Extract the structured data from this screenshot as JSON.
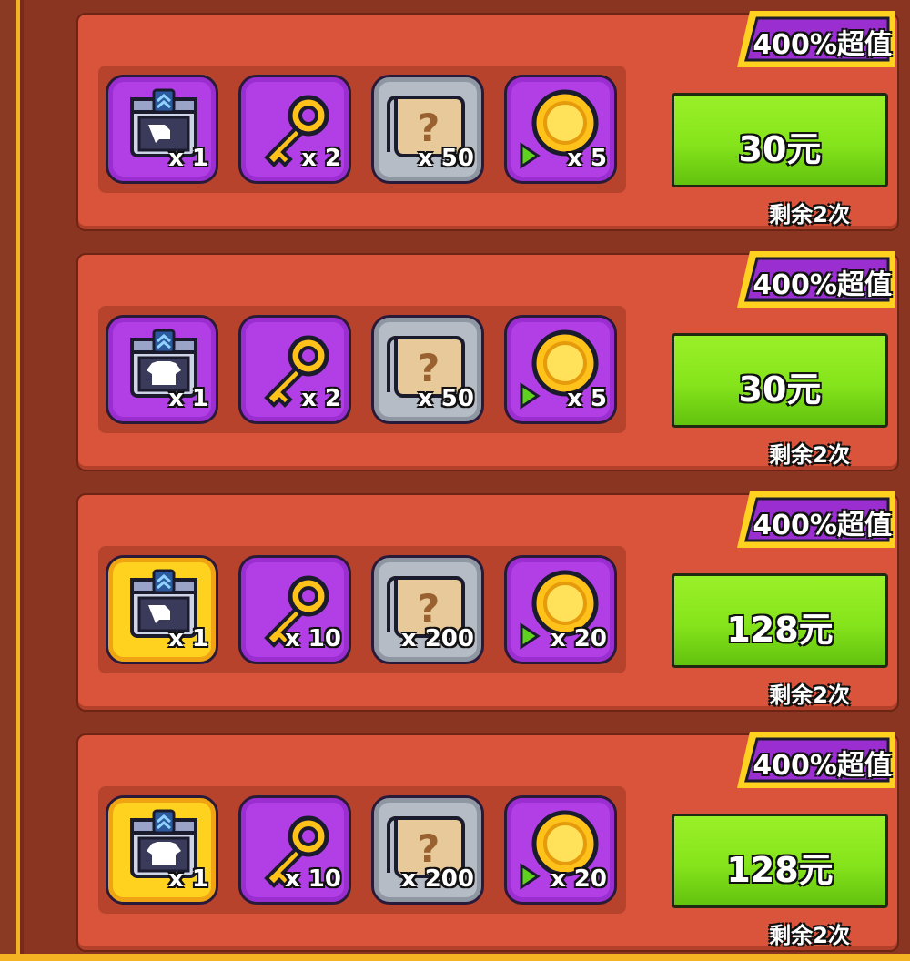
{
  "colors": {
    "panel_bg": "#8a3522",
    "card_bg": "#d9543a",
    "gold_frame": "#f4b323",
    "purple_slot": "#b23ee6",
    "gold_slot": "#ffd21f",
    "gray_slot": "#b6bcc6",
    "buy_button": "#85e41b"
  },
  "packs": [
    {
      "badge": "400%超值",
      "price": "30元",
      "remaining": "剩余2次",
      "items": [
        {
          "icon": "costume-chest-icon",
          "rarity": "purple",
          "qty": "x 1"
        },
        {
          "icon": "golden-key-icon",
          "rarity": "purple",
          "qty": "x 2"
        },
        {
          "icon": "mystery-scroll-icon",
          "rarity": "gray",
          "qty": "x 50"
        },
        {
          "icon": "gold-coin-icon",
          "rarity": "purple",
          "qty": "x 5"
        }
      ]
    },
    {
      "badge": "400%超值",
      "price": "30元",
      "remaining": "剩余2次",
      "items": [
        {
          "icon": "shirt-chest-icon",
          "rarity": "purple",
          "qty": "x 1"
        },
        {
          "icon": "golden-key-icon",
          "rarity": "purple",
          "qty": "x 2"
        },
        {
          "icon": "mystery-scroll-icon",
          "rarity": "gray",
          "qty": "x 50"
        },
        {
          "icon": "gold-coin-icon",
          "rarity": "purple",
          "qty": "x 5"
        }
      ]
    },
    {
      "badge": "400%超值",
      "price": "128元",
      "remaining": "剩余2次",
      "items": [
        {
          "icon": "costume-chest-icon",
          "rarity": "gold",
          "qty": "x 1"
        },
        {
          "icon": "golden-key-icon",
          "rarity": "purple",
          "qty": "x 10"
        },
        {
          "icon": "mystery-scroll-icon",
          "rarity": "gray",
          "qty": "x 200"
        },
        {
          "icon": "gold-coin-icon",
          "rarity": "purple",
          "qty": "x 20"
        }
      ]
    },
    {
      "badge": "400%超值",
      "price": "128元",
      "remaining": "剩余2次",
      "items": [
        {
          "icon": "shirt-chest-icon",
          "rarity": "gold",
          "qty": "x 1"
        },
        {
          "icon": "golden-key-icon",
          "rarity": "purple",
          "qty": "x 10"
        },
        {
          "icon": "mystery-scroll-icon",
          "rarity": "gray",
          "qty": "x 200"
        },
        {
          "icon": "gold-coin-icon",
          "rarity": "purple",
          "qty": "x 20"
        }
      ]
    }
  ]
}
